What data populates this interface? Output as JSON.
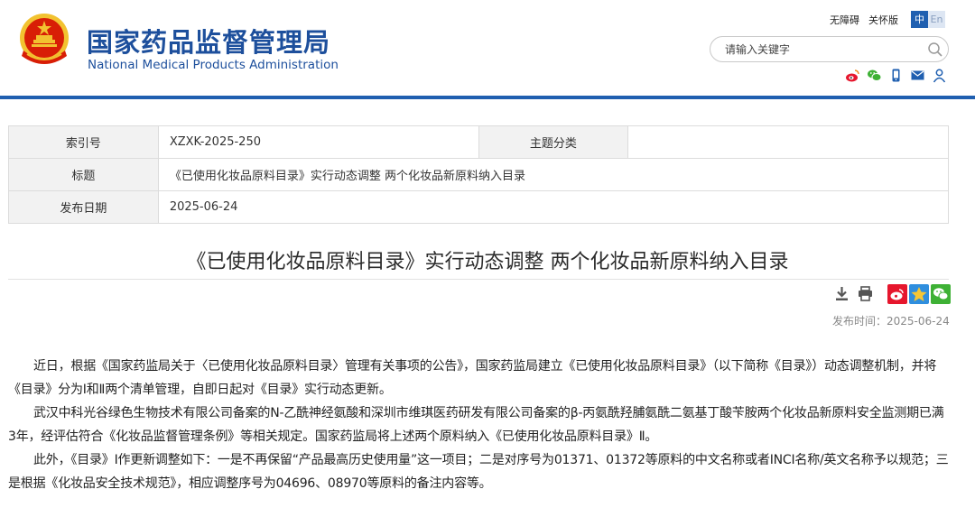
{
  "header": {
    "site_name_cn": "国家药品监督管理局",
    "site_name_en": "National Medical Products Administration",
    "links": {
      "accessibility": "无障碍",
      "care_mode": "关怀版"
    },
    "lang": {
      "cn": "中",
      "en": "En"
    },
    "search": {
      "placeholder": "请输入关键字",
      "value": ""
    },
    "social_icons": [
      "weibo-icon",
      "wechat-icon",
      "mobile-icon",
      "mail-icon",
      "user-icon"
    ]
  },
  "meta_table": {
    "index_label": "索引号",
    "index_value": "XZXK-2025-250",
    "topic_label": "主题分类",
    "topic_value": "",
    "title_label": "标题",
    "title_value": "《已使用化妆品原料目录》实行动态调整 两个化妆品新原料纳入目录",
    "date_label": "发布日期",
    "date_value": "2025-06-24"
  },
  "article": {
    "title": "《已使用化妆品原料目录》实行动态调整 两个化妆品新原料纳入目录",
    "publish_time": "发布时间：2025-06-24",
    "paragraphs": [
      "近日，根据《国家药监局关于〈已使用化妆品原料目录〉管理有关事项的公告》，国家药监局建立《已使用化妆品原料目录》（以下简称《目录》）动态调整机制，并将《目录》分为Ⅰ和Ⅱ两个清单管理，自即日起对《目录》实行动态更新。",
      "武汉中科光谷绿色生物技术有限公司备案的N-乙酰神经氨酸和深圳市维琪医药研发有限公司备案的β-丙氨酰羟脯氨酰二氨基丁酸苄胺两个化妆品新原料安全监测期已满3年，经评估符合《化妆品监督管理条例》等相关规定。国家药监局将上述两个原料纳入《已使用化妆品原料目录》Ⅱ。",
      "此外，《目录》Ⅰ作更新调整如下：一是不再保留“产品最高历史使用量”这一项目；二是对序号为01371、01372等原料的中文名称或者INCI名称/英文名称予以规范；三是根据《化妆品安全技术规范》，相应调整序号为04696、08970等原料的备注内容等。"
    ]
  },
  "tools": {
    "left": [
      "download-icon",
      "print-icon"
    ],
    "share": [
      "weibo-share-icon",
      "qzone-share-icon",
      "wechat-share-icon"
    ]
  },
  "colors": {
    "brand_blue": "#1f5fb0",
    "emblem_red": "#d81e06",
    "emblem_gold": "#f2c230"
  }
}
